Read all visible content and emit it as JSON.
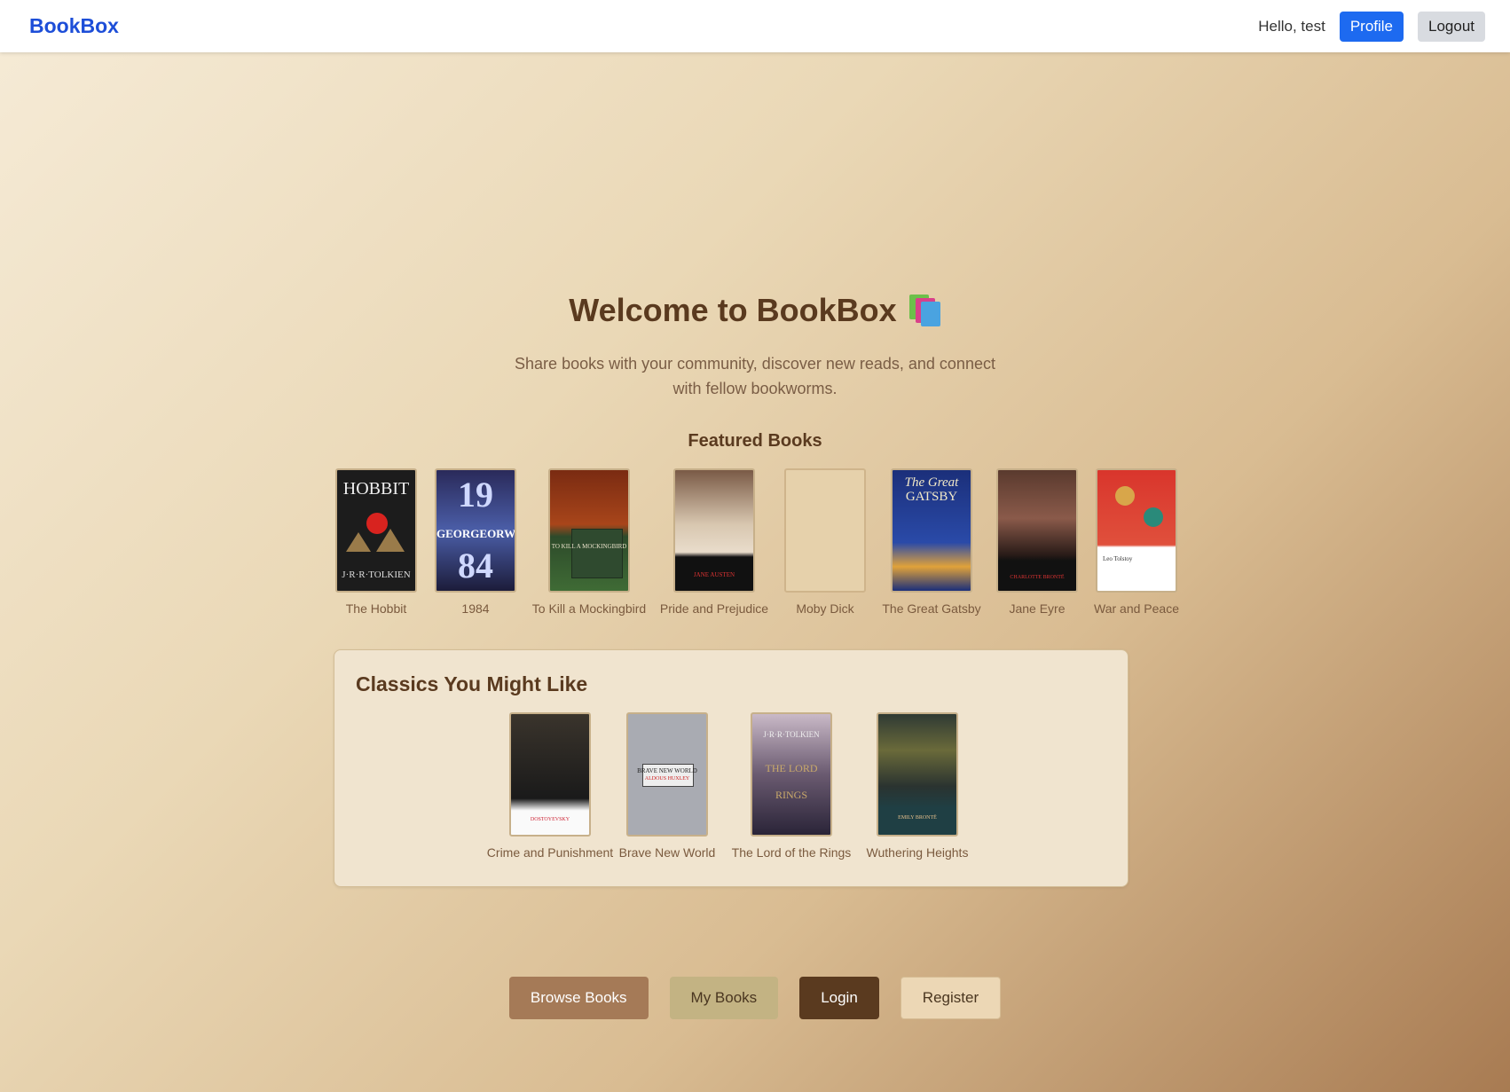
{
  "navbar": {
    "brand": "BookBox",
    "greeting": "Hello, test",
    "profile_label": "Profile",
    "logout_label": "Logout"
  },
  "hero": {
    "title": "Welcome to BookBox",
    "subtitle_line1": "Share books with your community, discover new reads, and connect",
    "subtitle_line2": "with fellow bookworms."
  },
  "featured": {
    "heading": "Featured Books",
    "books": [
      {
        "title": "The Hobbit"
      },
      {
        "title": "1984"
      },
      {
        "title": "To Kill a Mockingbird"
      },
      {
        "title": "Pride and Prejudice"
      },
      {
        "title": "Moby Dick"
      },
      {
        "title": "The Great Gatsby"
      },
      {
        "title": "Jane Eyre"
      },
      {
        "title": "War and Peace"
      }
    ]
  },
  "classics": {
    "heading": "Classics You Might Like",
    "books": [
      {
        "title": "Crime and Punishment"
      },
      {
        "title": "Brave New World"
      },
      {
        "title": "The Lord of the Rings"
      },
      {
        "title": "Wuthering Heights"
      }
    ]
  },
  "actions": {
    "browse_label": "Browse Books",
    "mybooks_label": "My Books",
    "login_label": "Login",
    "register_label": "Register"
  },
  "colors": {
    "brand": "#1d4ed8",
    "primary_button": "#1d6af0",
    "heading": "#5a3a1f"
  }
}
